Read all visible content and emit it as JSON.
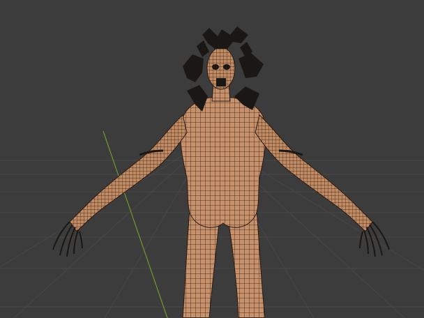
{
  "viewport": {
    "background_color": "#3c3c3c",
    "grid_color": "#4a4a4a",
    "y_axis_color": "#6c9a2e",
    "skin_color": "#c6916b",
    "wire_color": "#2a1a12",
    "hair_color": "#1b1714"
  }
}
